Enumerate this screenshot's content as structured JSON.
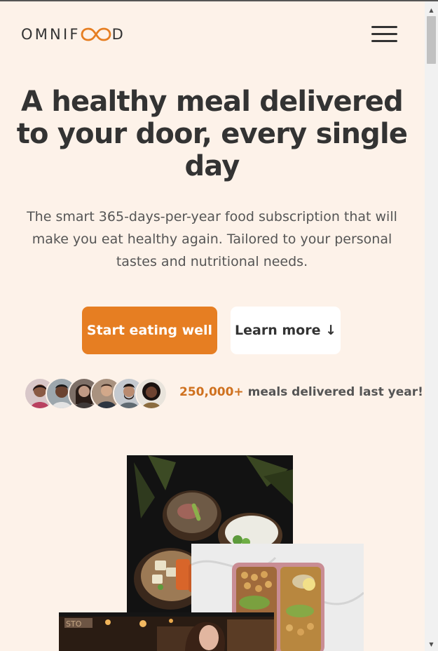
{
  "brand": {
    "logo_text_left": "OMNIF",
    "logo_text_right": "D",
    "accent": "#e67e22",
    "accent_dark": "#cf711f",
    "background": "#fdf2e9"
  },
  "nav": {
    "menu_icon": "hamburger-menu-icon"
  },
  "hero": {
    "title": "A healthy meal delivered to your door, every single day",
    "description": "The smart 365-days-per-year food subscription that will make you eat healthy again. Tailored to your personal tastes and nutritional needs.",
    "primary_button": "Start eating well",
    "secondary_button": "Learn more ↓",
    "meals_count": "250,000+",
    "meals_text": " meals delivered last year!"
  },
  "customers": {
    "count": 6
  },
  "images": {
    "bowls": "food-bowls-photo",
    "containers": "meal-prep-containers-photo",
    "person": "restaurant-woman-photo"
  },
  "scrollbar": {
    "up_icon": "scroll-up-arrow-icon",
    "down_icon": "scroll-down-arrow-icon"
  }
}
